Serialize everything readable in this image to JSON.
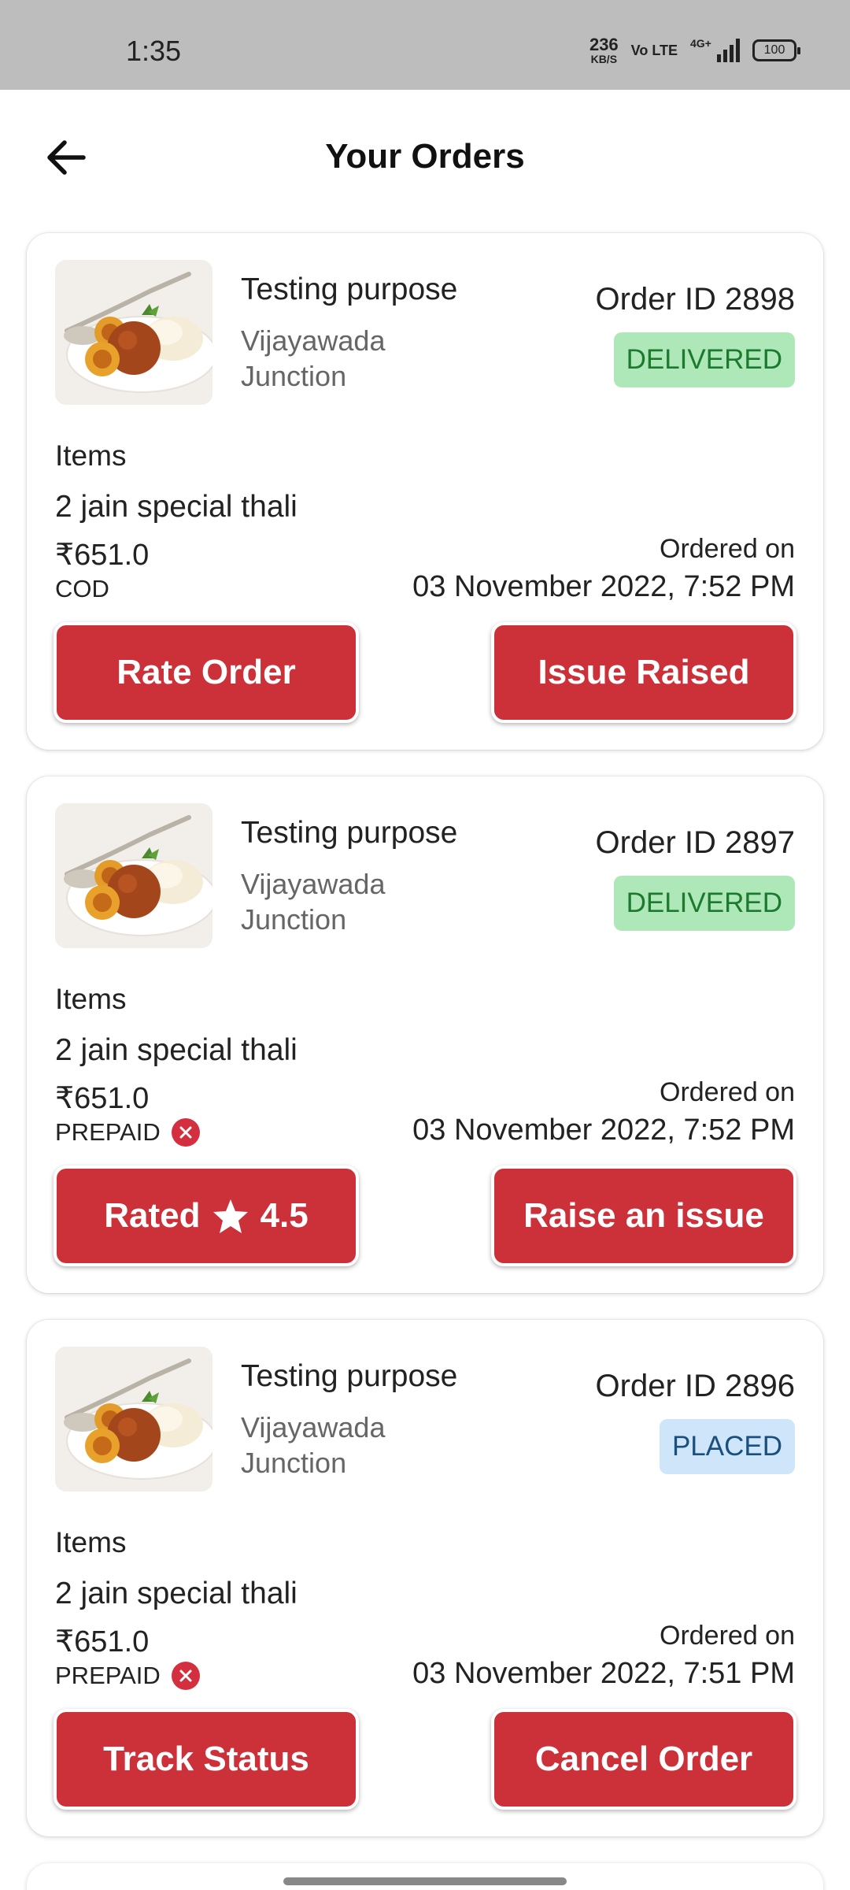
{
  "status_bar": {
    "time": "1:35",
    "net_speed": "236",
    "net_unit": "KB/S",
    "volte": "Vo LTE",
    "network": "4G+",
    "battery": "100"
  },
  "header": {
    "title": "Your Orders",
    "back_icon": "arrow-left-icon"
  },
  "orders": [
    {
      "shop": "Testing purpose",
      "location": "Vijayawada Junction",
      "order_id": "Order ID 2898",
      "status": "DELIVERED",
      "items_label": "Items",
      "items": "2 jain special thali",
      "price": "₹651.0",
      "payment": "COD",
      "ordered_label": "Ordered on",
      "ordered_date": "03 November 2022, 7:52 PM",
      "left_button": "Rate Order",
      "right_button": "Issue Raised"
    },
    {
      "shop": "Testing purpose",
      "location": "Vijayawada Junction",
      "order_id": "Order ID 2897",
      "status": "DELIVERED",
      "items_label": "Items",
      "items": "2 jain special thali",
      "price": "₹651.0",
      "payment": "PREPAID",
      "ordered_label": "Ordered on",
      "ordered_date": "03 November 2022, 7:52 PM",
      "left_button_prefix": "Rated",
      "left_button_rating": "4.5",
      "right_button": "Raise an issue"
    },
    {
      "shop": "Testing purpose",
      "location": "Vijayawada Junction",
      "order_id": "Order ID 2896",
      "status": "PLACED",
      "items_label": "Items",
      "items": "2 jain special thali",
      "price": "₹651.0",
      "payment": "PREPAID",
      "ordered_label": "Ordered on",
      "ordered_date": "03 November 2022, 7:51 PM",
      "left_button": "Track Status",
      "right_button": "Cancel Order"
    }
  ],
  "colors": {
    "button": "#cc3139",
    "delivered_bg": "#aee8b8",
    "delivered_text": "#1c7a2f",
    "placed_bg": "#cfe5fa",
    "placed_text": "#1a4f7e"
  }
}
